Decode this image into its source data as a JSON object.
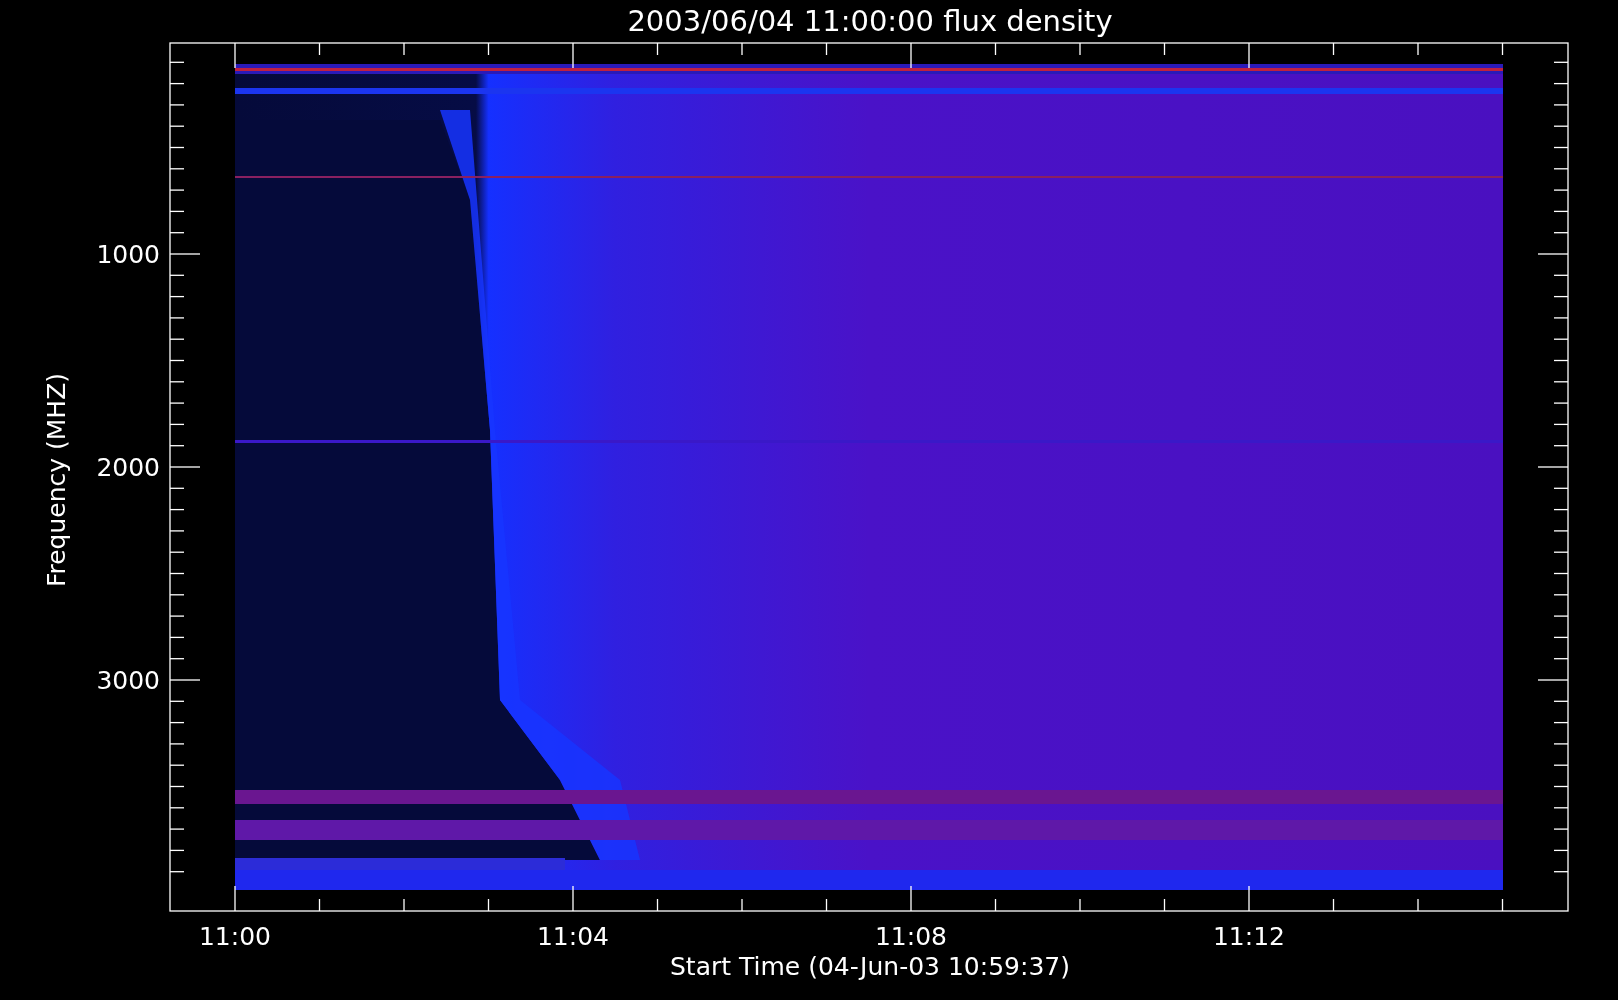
{
  "title": "2003/06/04 11:00:00 flux density",
  "x_axis": {
    "label": "Start Time (04-Jun-03 10:59:37)",
    "ticks": [
      "11:00",
      "11:04",
      "11:08",
      "11:12"
    ]
  },
  "y_axis": {
    "label": "Frequency (MHZ)",
    "ticks": [
      "1000",
      "2000",
      "3000"
    ]
  }
}
